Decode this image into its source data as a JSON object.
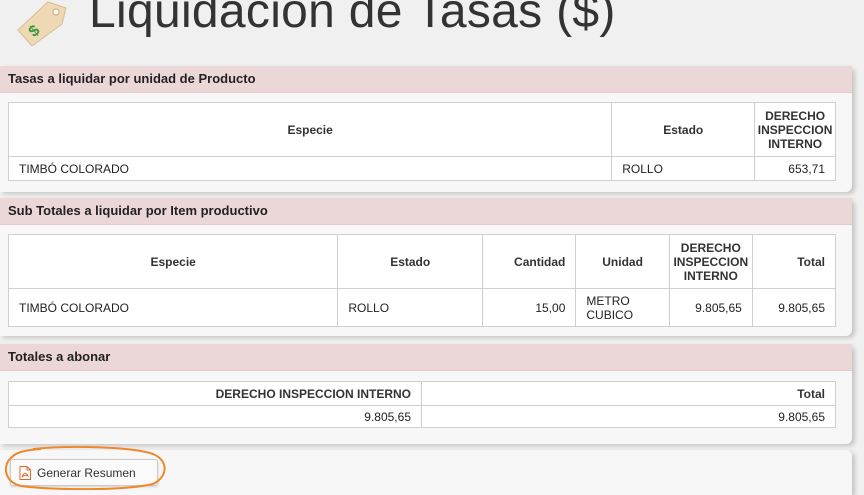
{
  "page": {
    "title": "Liquidación de Tasas ($)"
  },
  "section_unit": {
    "heading": "Tasas a liquidar por unidad de Producto",
    "columns": [
      "Especie",
      "Estado",
      "DERECHO INSPECCION INTERNO"
    ],
    "rows": [
      [
        "TIMBÓ COLORADO",
        "ROLLO",
        "653,71"
      ]
    ]
  },
  "section_item": {
    "heading": "Sub Totales a liquidar por Item productivo",
    "columns": [
      "Especie",
      "Estado",
      "Cantidad",
      "Unidad",
      "DERECHO INSPECCION INTERNO",
      "Total"
    ],
    "rows": [
      [
        "TIMBÓ COLORADO",
        "ROLLO",
        "15,00",
        "METRO CUBICO",
        "9.805,65",
        "9.805,65"
      ]
    ]
  },
  "section_totals": {
    "heading": "Totales a abonar",
    "columns": [
      "DERECHO INSPECCION INTERNO",
      "Total"
    ],
    "rows": [
      [
        "9.805,65",
        "9.805,65"
      ]
    ]
  },
  "actions": {
    "generate_summary": "Generar Resumen"
  },
  "icons": {
    "title_icon": "price-tag-icon",
    "button_icon": "pdf-file-icon"
  },
  "colors": {
    "section_header_bg": "#ecd7d8",
    "highlight_ring": "#f0882a",
    "tag": "#efd9b5",
    "dollar": "#3a9a3a"
  }
}
